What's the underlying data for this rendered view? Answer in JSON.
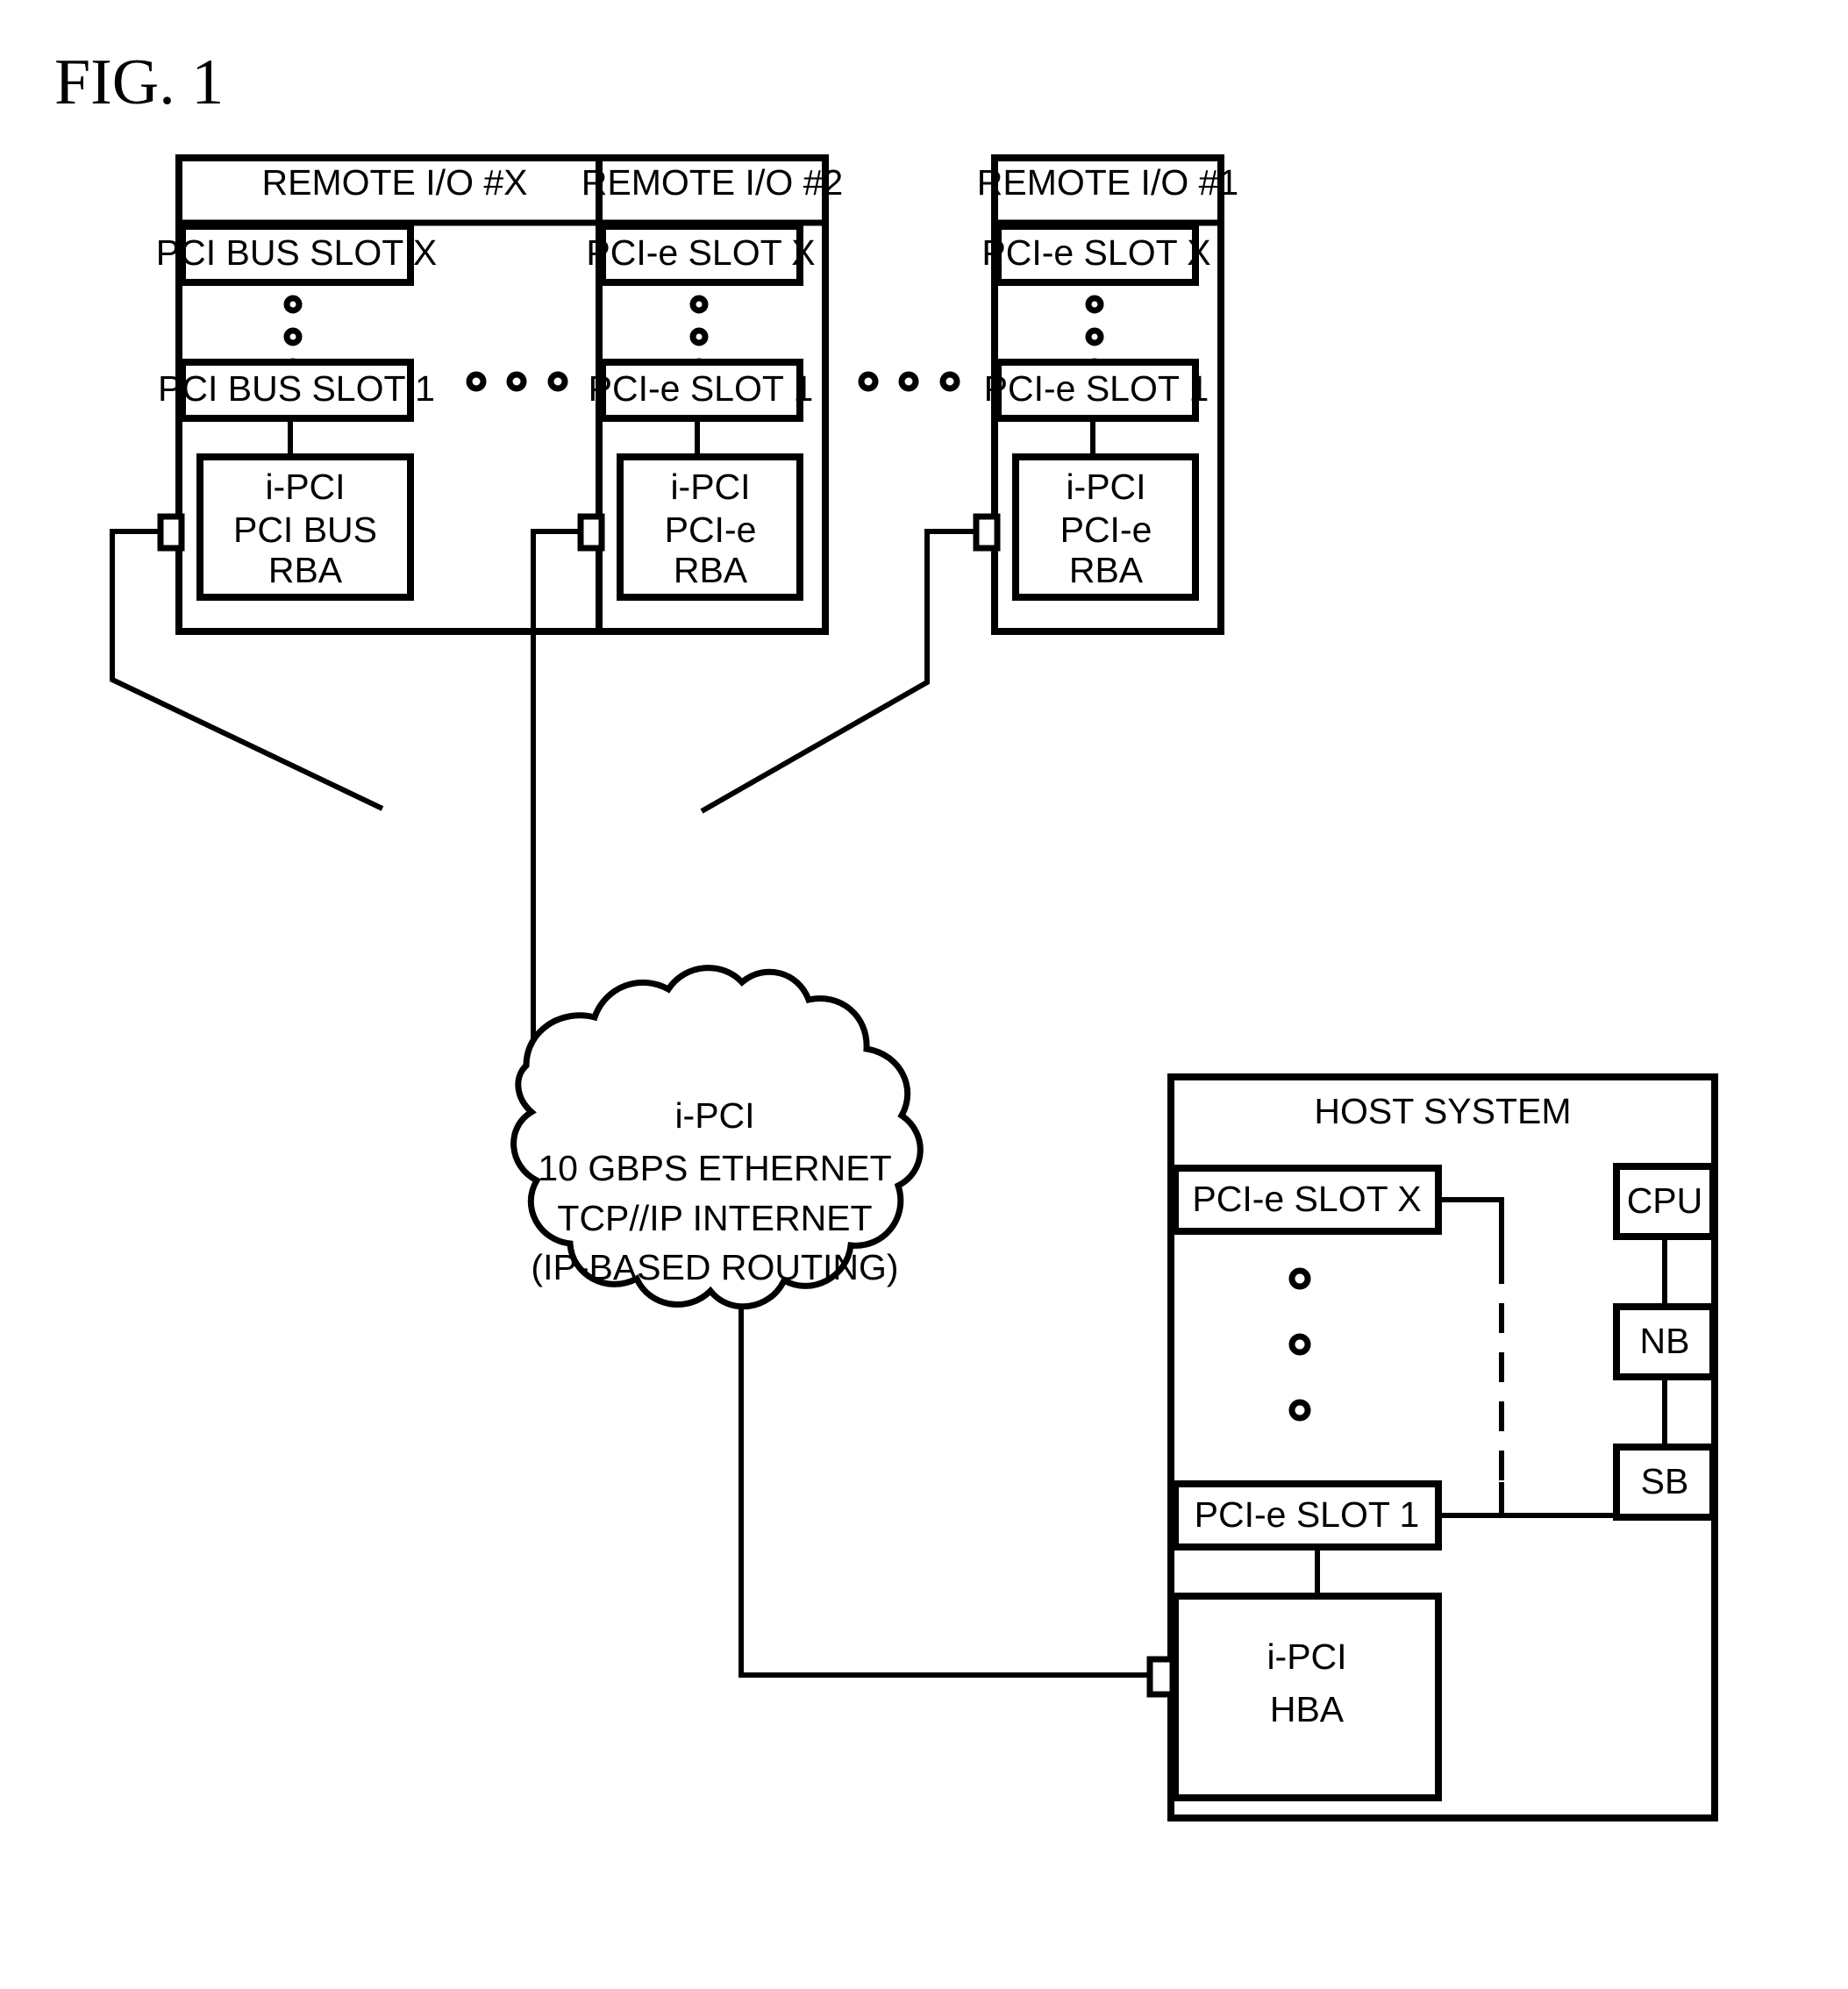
{
  "figure": {
    "title": "FIG. 1",
    "domain_note": "patent block diagram"
  },
  "remote_blocks": [
    {
      "title": "REMOTE I/O #X",
      "slot_top": "PCI BUS SLOT X",
      "slot_bottom": "PCI BUS SLOT 1",
      "adapter_line1": "i-PCI",
      "adapter_line2": "PCI BUS",
      "adapter_line3": "RBA",
      "vertical_ellipsis_count": 3
    },
    {
      "title": "REMOTE I/O #2",
      "slot_top": "PCI-e SLOT X",
      "slot_bottom": "PCI-e SLOT 1",
      "adapter_line1": "i-PCI",
      "adapter_line2": "PCI-e",
      "adapter_line3": "RBA",
      "vertical_ellipsis_count": 3
    },
    {
      "title": "REMOTE I/O #1",
      "slot_top": "PCI-e SLOT X",
      "slot_bottom": "PCI-e SLOT 1",
      "adapter_line1": "i-PCI",
      "adapter_line2": "PCI-e",
      "adapter_line3": "RBA",
      "vertical_ellipsis_count": 3
    }
  ],
  "horizontal_ellipses": {
    "count_per_group": 3,
    "groups": 2
  },
  "network_cloud": {
    "line1": "i-PCI",
    "line2": "10 GBPS ETHERNET",
    "line3": "TCP//IP INTERNET",
    "line4": "(IP-BASED ROUTING)"
  },
  "host_system": {
    "title": "HOST SYSTEM",
    "slot_top": "PCI-e SLOT X",
    "slot_bottom": "PCI-e SLOT 1",
    "vertical_ellipsis_count": 3,
    "cpu": "CPU",
    "northbridge": "NB",
    "southbridge": "SB",
    "hba_line1": "i-PCI",
    "hba_line2": "HBA"
  },
  "colors": {
    "ink": "#000000",
    "paper": "#ffffff"
  }
}
